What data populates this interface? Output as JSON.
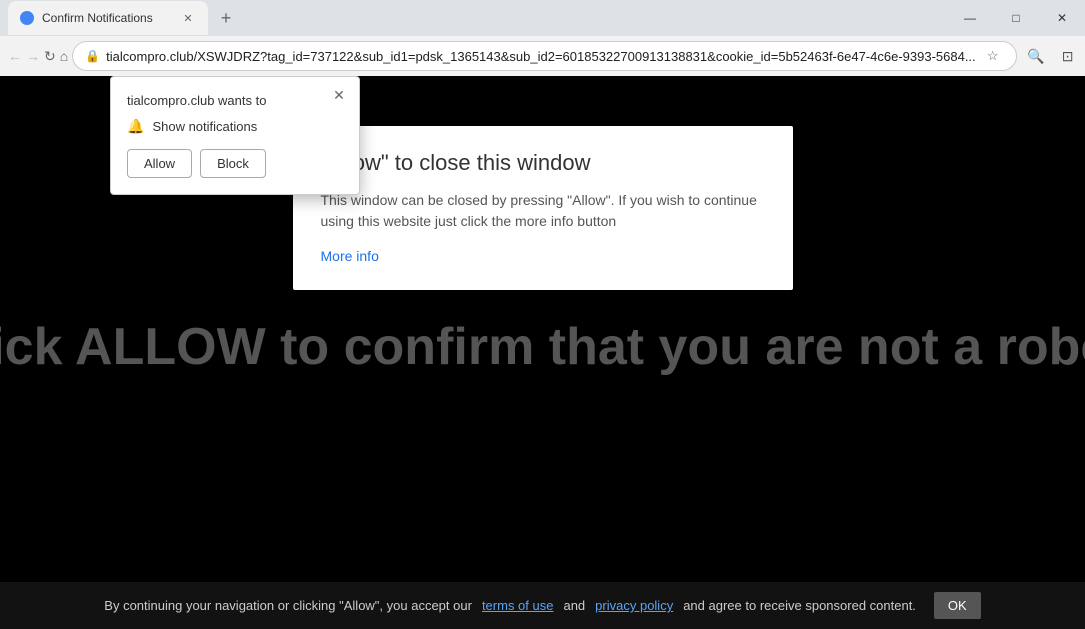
{
  "browser": {
    "tab": {
      "title": "Confirm Notifications",
      "favicon_color": "#4285f4"
    },
    "address": "tialcompro.club/XSWJDRZ?tag_id=737122&sub_id1=pdsk_1365143&sub_id2=60185322700913138831&cookie_id=5b52463f-6e47-4c6e-9393-5684...",
    "nav": {
      "back_disabled": true,
      "forward_disabled": true
    }
  },
  "popup": {
    "title": "tialcompro.club wants to",
    "notification_label": "Show notifications",
    "allow_label": "Allow",
    "block_label": "Block"
  },
  "content_box": {
    "title": "\"Allow\" to close this window",
    "body": "This window can be closed by pressing \"Allow\". If you wish to continue using this website just click the more info button",
    "more_info_label": "More info"
  },
  "page": {
    "main_text": "Click ALLOW to confirm that you are not a robot!"
  },
  "bottom_bar": {
    "text": "By continuing your navigation or clicking \"Allow\", you accept our",
    "terms_label": "terms of use",
    "and_text": "and",
    "privacy_label": "privacy policy",
    "end_text": "and agree to receive sponsored content.",
    "ok_label": "OK"
  }
}
